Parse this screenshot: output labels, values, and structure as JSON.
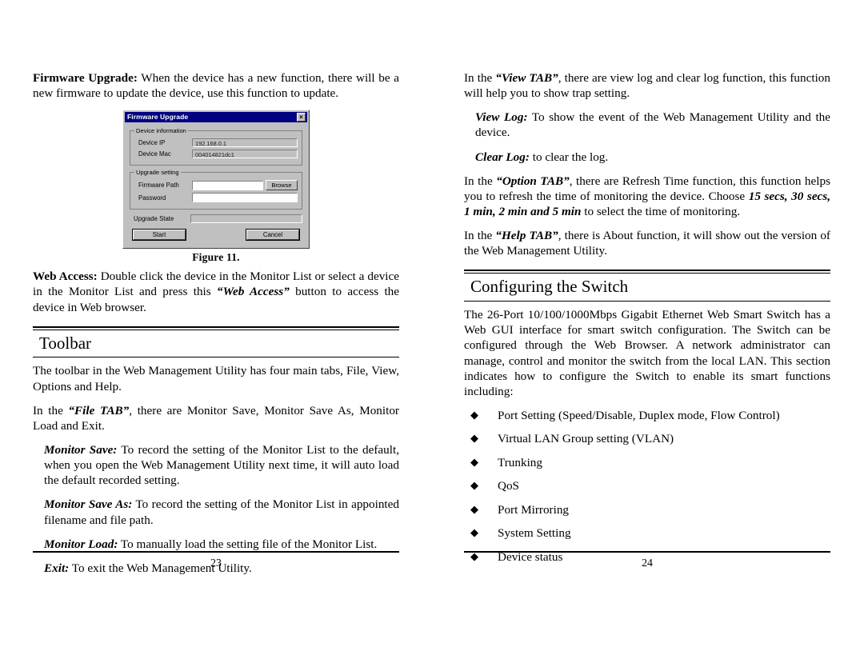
{
  "document": {
    "left_page": {
      "page_number": "23",
      "firmware_upgrade": {
        "term": "Firmware Upgrade:",
        "text": " When the device has a new function, there will be a new firmware to update the device, use this function to update."
      },
      "figure": {
        "caption": "Figure 11.",
        "dialog": {
          "title": "Firmware Upgrade",
          "close_label": "×",
          "device_information": {
            "legend": "Device information",
            "device_ip_label": "Device IP",
            "device_ip_value": "192.168.0.1",
            "device_mac_label": "Device Mac",
            "device_mac_value": "004014821dc1"
          },
          "upgrade_setting": {
            "legend": "Upgrade setting",
            "firmware_path_label": "Firmware Path",
            "firmware_path_value": "",
            "browse_label": "Browse",
            "password_label": "Password",
            "password_value": ""
          },
          "upgrade_state_label": "Upgrade State",
          "upgrade_state_value": "",
          "start_label": "Start",
          "cancel_label": "Cancel"
        }
      },
      "web_access": {
        "term": "Web Access:",
        "text_1": " Double click the device in the Monitor List or select a device in the Monitor List and press this ",
        "emphasis": "“Web Access”",
        "text_2": " button to access the device in Web browser."
      },
      "toolbar_section": {
        "heading": "Toolbar",
        "intro": "The toolbar in the Web Management Utility has four main tabs, File, View, Options and Help.",
        "file_tab_text_1": "In the ",
        "file_tab_emphasis": "“File TAB”",
        "file_tab_text_2": ", there are Monitor Save, Monitor Save As, Monitor Load and Exit.",
        "items": [
          {
            "term": "Monitor Save:",
            "text": " To record the setting of the Monitor List to the default, when you open the Web Management Utility next time, it will auto load the default recorded setting."
          },
          {
            "term": "Monitor Save As:",
            "text": " To record the setting of the Monitor List in appointed filename and file path."
          },
          {
            "term": "Monitor Load:",
            "text": " To manually load the setting file of the Monitor List."
          },
          {
            "term": "Exit:",
            "text": " To exit the Web Management Utility."
          }
        ]
      }
    },
    "right_page": {
      "page_number": "24",
      "view_tab": {
        "text_1": "In the ",
        "emphasis": "“View TAB”",
        "text_2": ", there are view log and clear log function, this function will help you to show trap setting.",
        "items": [
          {
            "term": "View Log:",
            "text": " To show the event of the Web Management Utility and the device."
          },
          {
            "term": "Clear Log:",
            "text": " to clear the log."
          }
        ]
      },
      "option_tab": {
        "text_1": "In the ",
        "emphasis": "“Option TAB”",
        "text_2": ", there are Refresh Time function, this function helps you to refresh the time of monitoring the device. Choose ",
        "emphasis_2": "15 secs, 30 secs, 1 min, 2 min and 5 min",
        "text_3": " to select the time of monitoring."
      },
      "help_tab": {
        "text_1": "In the ",
        "emphasis": "“Help TAB”",
        "text_2": ", there is About function, it will show out the version of the Web Management Utility."
      },
      "configuring_section": {
        "heading": "Configuring the Switch",
        "intro": "The 26-Port 10/100/1000Mbps Gigabit Ethernet Web Smart Switch has a Web GUI interface for smart switch configuration. The Switch can be configured through the Web Browser. A network administrator can manage, control and monitor the switch from the local LAN. This section indicates how to configure the Switch to enable its smart functions including:",
        "bullet_glyph": "◆",
        "bullets": [
          "Port Setting (Speed/Disable, Duplex mode, Flow Control)",
          "Virtual LAN Group setting (VLAN)",
          "Trunking",
          "QoS",
          "Port Mirroring",
          "System Setting",
          "Device status"
        ]
      }
    }
  }
}
